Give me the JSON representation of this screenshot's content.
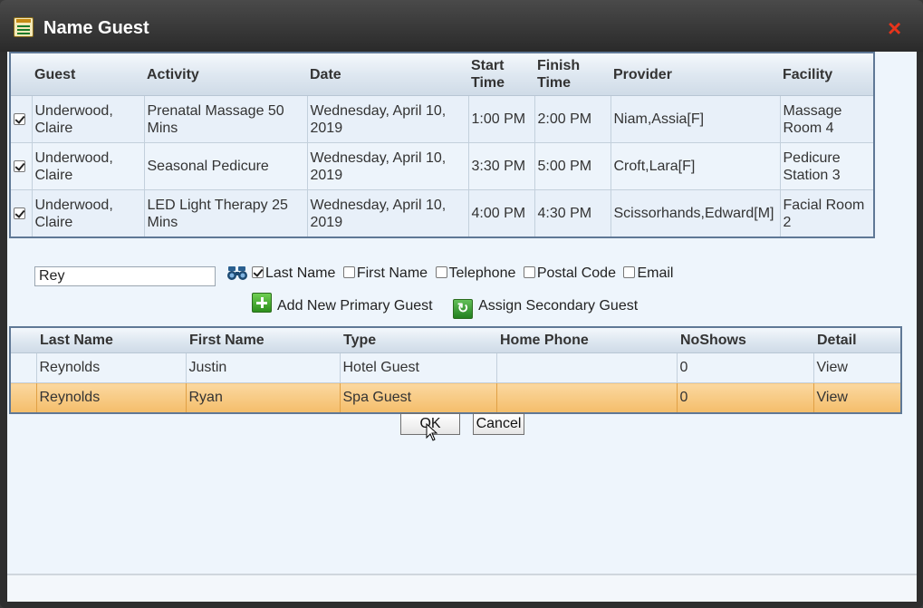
{
  "dialog": {
    "title": "Name Guest",
    "close_label": "×"
  },
  "appointments": {
    "columns": [
      "Guest",
      "Activity",
      "Date",
      "Start Time",
      "Finish Time",
      "Provider",
      "Facility"
    ],
    "rows": [
      {
        "checked": true,
        "guest": "Underwood, Claire",
        "activity": "Prenatal Massage 50 Mins",
        "date": "Wednesday, April 10, 2019",
        "start": "1:00 PM",
        "finish": "2:00 PM",
        "provider": "Niam,Assia[F]",
        "facility": "Massage Room 4"
      },
      {
        "checked": true,
        "guest": "Underwood, Claire",
        "activity": "Seasonal Pedicure",
        "date": "Wednesday, April 10, 2019",
        "start": "3:30 PM",
        "finish": "5:00 PM",
        "provider": "Croft,Lara[F]",
        "facility": "Pedicure Station 3"
      },
      {
        "checked": true,
        "guest": "Underwood, Claire",
        "activity": "LED Light Therapy 25 Mins",
        "date": "Wednesday, April 10, 2019",
        "start": "4:00 PM",
        "finish": "4:30 PM",
        "provider": "Scissorhands,Edward[M]",
        "facility": "Facial Room 2"
      }
    ]
  },
  "search": {
    "value": "Rey",
    "options": [
      {
        "label": "Last Name",
        "checked": true
      },
      {
        "label": "First Name",
        "checked": false
      },
      {
        "label": "Telephone",
        "checked": false
      },
      {
        "label": "Postal Code",
        "checked": false
      },
      {
        "label": "Email",
        "checked": false
      }
    ],
    "add_primary_label": "Add New Primary Guest",
    "assign_secondary_label": "Assign Secondary Guest"
  },
  "guests": {
    "columns": [
      "Last Name",
      "First Name",
      "Type",
      "Home Phone",
      "NoShows",
      "Detail"
    ],
    "rows": [
      {
        "last": "Reynolds",
        "first": "Justin",
        "type": "Hotel Guest",
        "phone": "",
        "noshows": "0",
        "detail": "View",
        "selected": false
      },
      {
        "last": "Reynolds",
        "first": "Ryan",
        "type": "Spa Guest",
        "phone": "",
        "noshows": "0",
        "detail": "View",
        "selected": true
      }
    ]
  },
  "buttons": {
    "ok": "OK",
    "cancel": "Cancel"
  },
  "colors": {
    "selected_row": "#f4bd6a",
    "close": "#e8341b",
    "header_border": "#5f7896"
  }
}
